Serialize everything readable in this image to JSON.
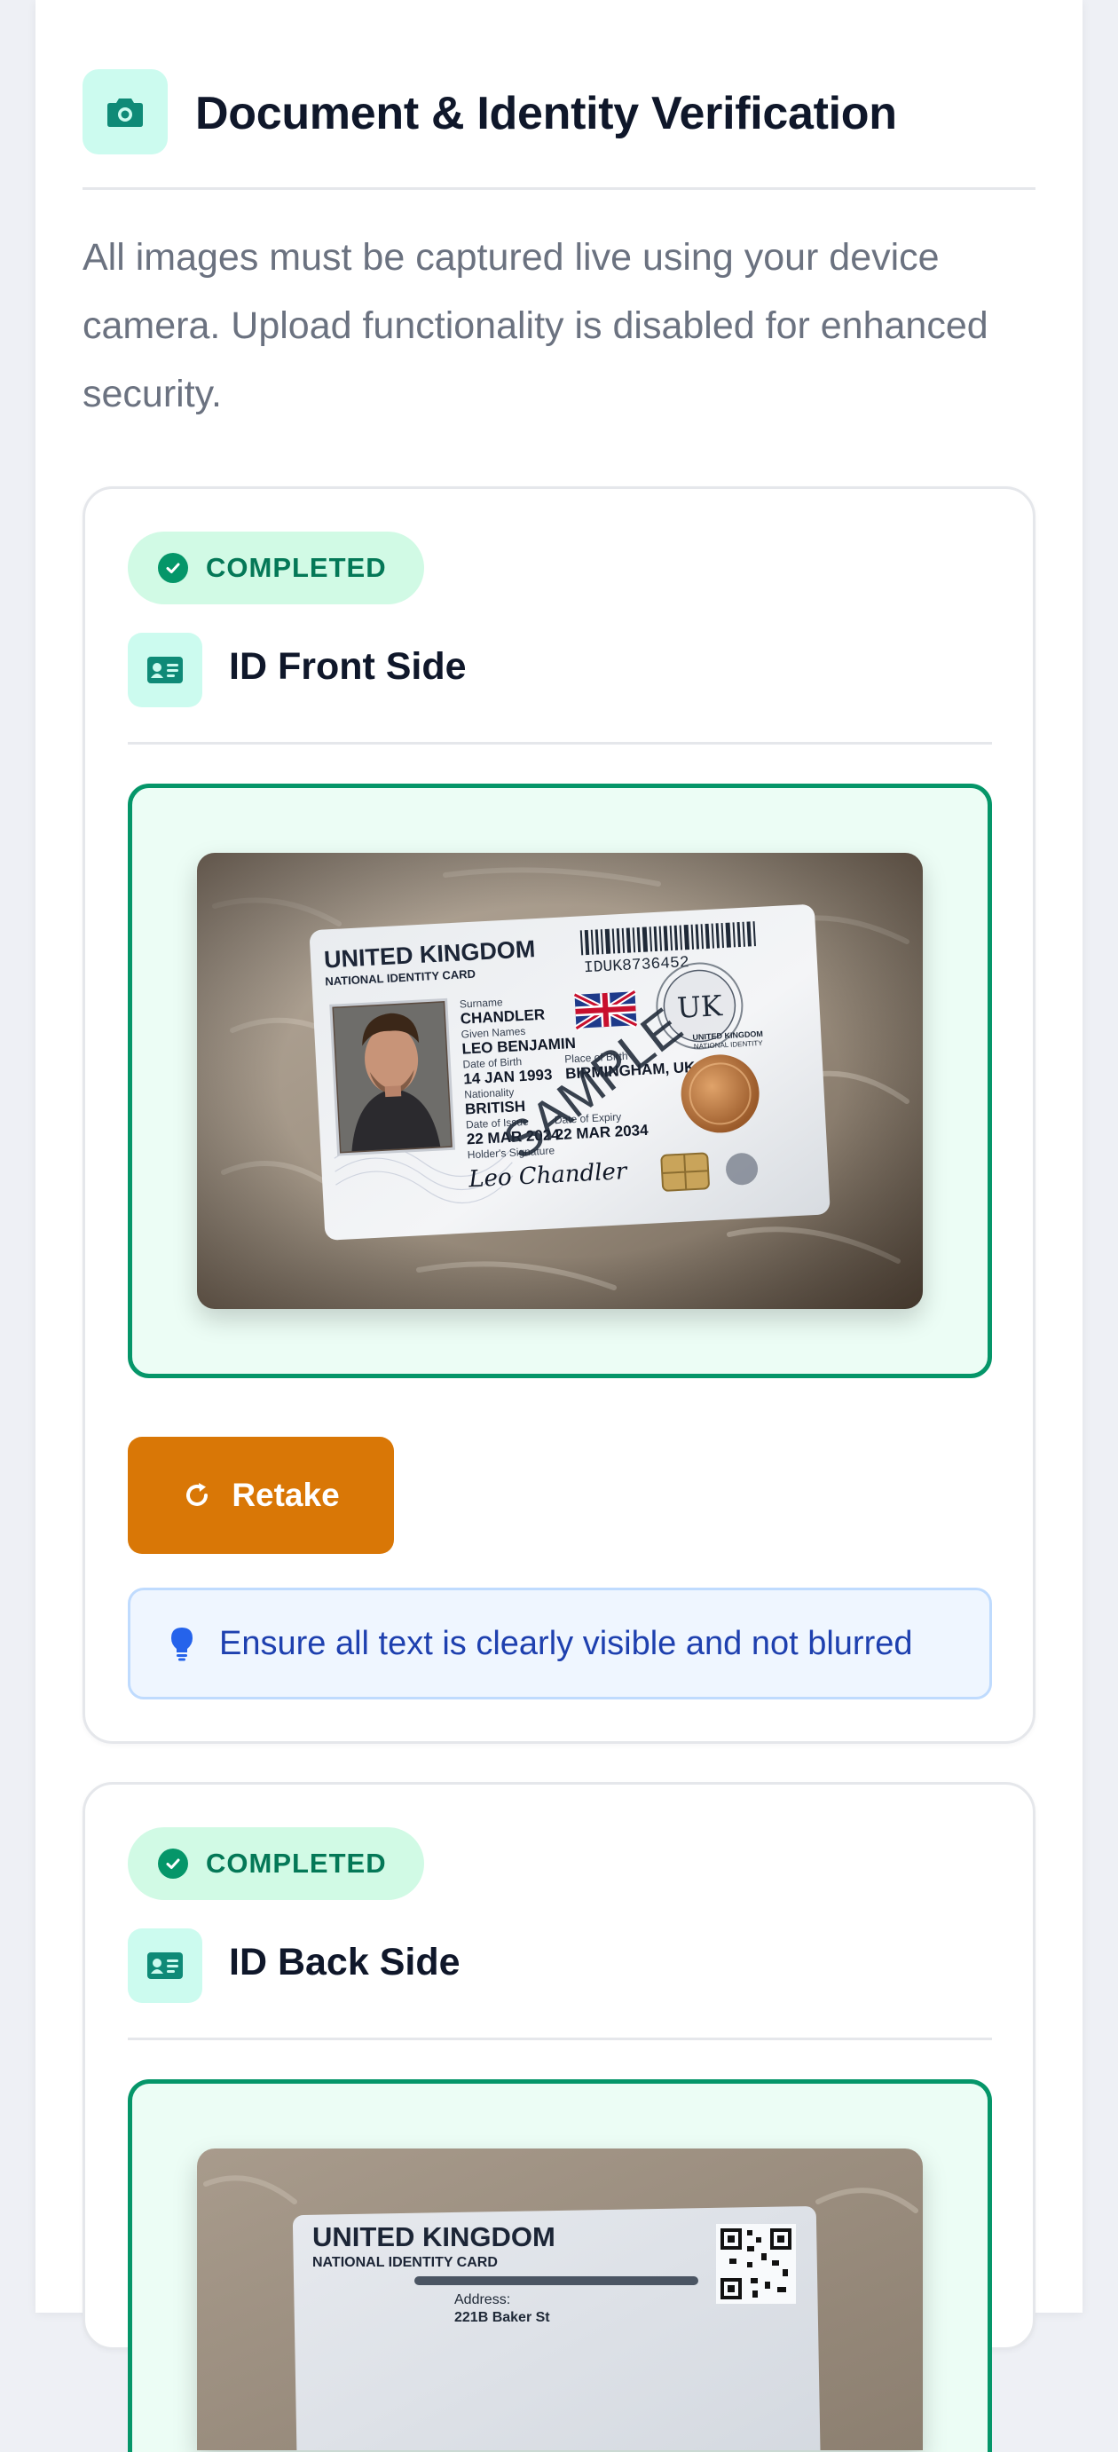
{
  "section": {
    "title": "Document & Identity Verification",
    "header_icon": "camera-icon",
    "intro": "All images must be captured live using your device camera. Upload functionality is disabled for enhanced security."
  },
  "steps": [
    {
      "status": "COMPLETED",
      "status_icon": "check-circle-icon",
      "title": "ID Front Side",
      "icon": "id-card-icon",
      "card": {
        "country": "UNITED KINGDOM",
        "card_type": "NATIONAL IDENTITY CARD",
        "number": "IDUK8736452",
        "surname_label": "Surname",
        "surname": "CHANDLER",
        "given_label": "Given Names",
        "given": "LEO BENJAMIN",
        "dob_label": "Date of Birth",
        "dob": "14 JAN 1993",
        "pob_label": "Place of Birth",
        "pob": "BIRMINGHAM, UK",
        "nationality_label": "Nationality",
        "nationality": "BRITISH",
        "issue_label": "Date of Issue",
        "issue": "22 MAR 2024",
        "expiry_label": "Date of Expiry",
        "expiry": "22 MAR 2034",
        "signature_label": "Holder's Signature",
        "signature": "Leo Chandler",
        "watermark": "SAMPLE",
        "seal": "UK",
        "seal_caption_1": "UNITED KINGDOM",
        "seal_caption_2": "NATIONAL IDENTITY"
      },
      "retake_label": "Retake",
      "retake_icon": "refresh-icon",
      "tip": "Ensure all text is clearly visible and not blurred",
      "tip_icon": "lightbulb-icon"
    },
    {
      "status": "COMPLETED",
      "status_icon": "check-circle-icon",
      "title": "ID Back Side",
      "icon": "id-card-icon",
      "card": {
        "country": "UNITED KINGDOM",
        "card_type": "NATIONAL IDENTITY CARD",
        "address_label": "Address:",
        "address": "221B Baker St"
      }
    }
  ],
  "colors": {
    "accent": "#059669",
    "accent_soft": "#ecfdf5",
    "badge_bg": "#d1fae5",
    "icon_bg": "#ccfbef",
    "retake": "#d97706",
    "tip_bg": "#eff6ff",
    "tip_text": "#1e40af"
  }
}
